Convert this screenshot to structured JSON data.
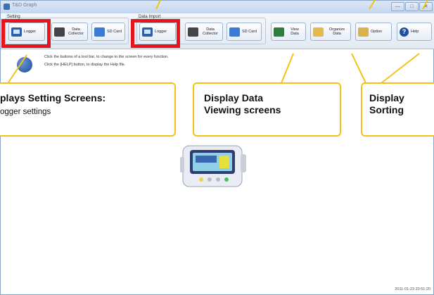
{
  "window": {
    "title_text": "T&D Graph",
    "controls": [
      "—",
      "□",
      "✕"
    ]
  },
  "toolbar": {
    "setting_group_label": "Setting",
    "data_import_group_label": "Data Import",
    "buttons": [
      {
        "label": "Logger",
        "icon": "logger-icon"
      },
      {
        "label": "Data Collector",
        "icon": "data-collector-icon"
      },
      {
        "label": "SD Card",
        "icon": "sd-card-icon"
      },
      {
        "label": "Logger",
        "icon": "logger-icon"
      },
      {
        "label": "Data Collector",
        "icon": "data-collector-icon"
      },
      {
        "label": "SD Card",
        "icon": "sd-card-icon"
      },
      {
        "label": "View Data",
        "icon": "view-data-icon"
      },
      {
        "label": "Organize Data",
        "icon": "organize-data-icon"
      },
      {
        "label": "Option",
        "icon": "option-icon"
      },
      {
        "label": "Help",
        "icon": "help-icon"
      }
    ]
  },
  "info": {
    "line1": "Click the buttons of a tool bar, to change to the screen for every function.",
    "line2": "Click the [HELP] button, to display the Help file."
  },
  "callouts": {
    "setting": {
      "title": "plays Setting Screens:",
      "subtitle": "ogger settings"
    },
    "view": {
      "title_line1": "Display Data",
      "title_line2": "Viewing screens"
    },
    "organize": {
      "title_line1": "Display",
      "title_line2": "Sorting"
    }
  },
  "colors": {
    "highlight_red": "#e8141b",
    "callout_border": "#f2c316",
    "toolbar_bg": "#e3eaf3"
  },
  "status": {
    "timestamp": "2011-01-23 20:51:20"
  }
}
